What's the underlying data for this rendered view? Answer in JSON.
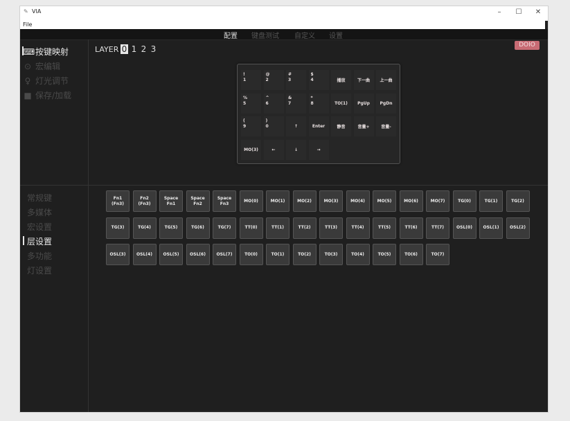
{
  "window": {
    "title": "VIA",
    "menu_file": "File",
    "controls": {
      "minimize": "–",
      "maximize": "☐",
      "close": "✕"
    }
  },
  "topnav": {
    "tabs": [
      {
        "label": "配置",
        "active": true
      },
      {
        "label": "键盘测试",
        "active": false
      },
      {
        "label": "自定义",
        "active": false
      },
      {
        "label": "设置",
        "active": false
      }
    ]
  },
  "sidebar": {
    "items": [
      {
        "label": "按键映射",
        "icon": "keyboard-icon",
        "glyph": "⌨",
        "active": true
      },
      {
        "label": "宏编辑",
        "icon": "target-icon",
        "glyph": "⊙",
        "active": false
      },
      {
        "label": "灯光调节",
        "icon": "bulb-icon",
        "glyph": "♀",
        "active": false
      },
      {
        "label": "保存/加载",
        "icon": "save-icon",
        "glyph": "■",
        "active": false
      }
    ],
    "categories": [
      {
        "label": "常规键",
        "active": false
      },
      {
        "label": "多媒体",
        "active": false
      },
      {
        "label": "宏设置",
        "active": false
      },
      {
        "label": "层设置",
        "active": true
      },
      {
        "label": "多功能",
        "active": false
      },
      {
        "label": "灯设置",
        "active": false
      }
    ]
  },
  "layers": {
    "label": "LAYER",
    "numbers": [
      "0",
      "1",
      "2",
      "3"
    ],
    "selected": "0"
  },
  "badge": "DOIO",
  "keyboard": {
    "rows": [
      [
        [
          "!",
          "1"
        ],
        [
          "@",
          "2"
        ],
        [
          "#",
          "3"
        ],
        [
          "$",
          "4"
        ],
        [
          "播放"
        ],
        [
          "下一曲"
        ],
        [
          "上一曲"
        ]
      ],
      [
        [
          "%",
          "5"
        ],
        [
          "^",
          "6"
        ],
        [
          "&",
          "7"
        ],
        [
          "*",
          "8"
        ],
        [
          "TO(1)"
        ],
        [
          "PgUp"
        ],
        [
          "PgDn"
        ]
      ],
      [
        [
          "(",
          "9"
        ],
        [
          ")",
          "0"
        ],
        [
          "↑"
        ],
        [
          "Enter"
        ],
        [
          "静音"
        ],
        [
          "音量+"
        ],
        [
          "音量-"
        ]
      ],
      [
        [
          "MO(3)"
        ],
        [
          "←"
        ],
        [
          "↓"
        ],
        [
          "→"
        ]
      ]
    ]
  },
  "palette": {
    "rows": [
      [
        [
          "Fn1",
          "(Fn3)"
        ],
        [
          "Fn2",
          "(Fn3)"
        ],
        [
          "Space",
          "Fn1"
        ],
        [
          "Space",
          "Fn2"
        ],
        [
          "Space",
          "Fn3"
        ],
        [
          "MO(0)"
        ],
        [
          "MO(1)"
        ],
        [
          "MO(2)"
        ],
        [
          "MO(3)"
        ],
        [
          "MO(4)"
        ],
        [
          "MO(5)"
        ],
        [
          "MO(6)"
        ],
        [
          "MO(7)"
        ],
        [
          "TG(0)"
        ],
        [
          "TG(1)"
        ],
        [
          "TG(2)"
        ]
      ],
      [
        [
          "TG(3)"
        ],
        [
          "TG(4)"
        ],
        [
          "TG(5)"
        ],
        [
          "TG(6)"
        ],
        [
          "TG(7)"
        ],
        [
          "TT(0)"
        ],
        [
          "TT(1)"
        ],
        [
          "TT(2)"
        ],
        [
          "TT(3)"
        ],
        [
          "TT(4)"
        ],
        [
          "TT(5)"
        ],
        [
          "TT(6)"
        ],
        [
          "TT(7)"
        ],
        [
          "OSL(0)"
        ],
        [
          "OSL(1)"
        ],
        [
          "OSL(2)"
        ]
      ],
      [
        [
          "OSL(3)"
        ],
        [
          "OSL(4)"
        ],
        [
          "OSL(5)"
        ],
        [
          "OSL(6)"
        ],
        [
          "OSL(7)"
        ],
        [
          "TO(0)"
        ],
        [
          "TO(1)"
        ],
        [
          "TO(2)"
        ],
        [
          "TO(3)"
        ],
        [
          "TO(4)"
        ],
        [
          "TO(5)"
        ],
        [
          "TO(6)"
        ],
        [
          "TO(7)"
        ]
      ]
    ]
  },
  "colors": {
    "background": "#1f1f1f",
    "accent": "#c86b74",
    "key": "#3a3a3a"
  }
}
